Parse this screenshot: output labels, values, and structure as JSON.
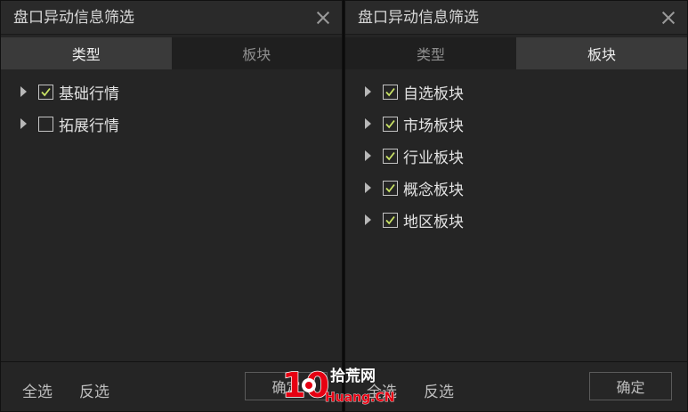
{
  "colors": {
    "panel": "#252525",
    "tab_active": "#3a3a3a",
    "check_mark": "#c9e265",
    "watermark_red": "#e60012"
  },
  "left_dialog": {
    "title": "盘口异动信息筛选",
    "tabs": [
      {
        "label": "类型",
        "active": true
      },
      {
        "label": "板块",
        "active": false
      }
    ],
    "items": [
      {
        "label": "基础行情",
        "checked": true
      },
      {
        "label": "拓展行情",
        "checked": false
      }
    ],
    "footer": {
      "select_all": "全选",
      "invert": "反选",
      "confirm": "确定"
    }
  },
  "right_dialog": {
    "title": "盘口异动信息筛选",
    "tabs": [
      {
        "label": "类型",
        "active": false
      },
      {
        "label": "板块",
        "active": true
      }
    ],
    "items": [
      {
        "label": "自选板块",
        "checked": true
      },
      {
        "label": "市场板块",
        "checked": true
      },
      {
        "label": "行业板块",
        "checked": true
      },
      {
        "label": "概念板块",
        "checked": true
      },
      {
        "label": "地区板块",
        "checked": true
      }
    ],
    "footer": {
      "select_all": "全选",
      "invert": "反选",
      "confirm": "确定"
    }
  },
  "watermark": {
    "number": "10",
    "site_cn": "拾荒网",
    "site_en": "Huang.CN"
  }
}
